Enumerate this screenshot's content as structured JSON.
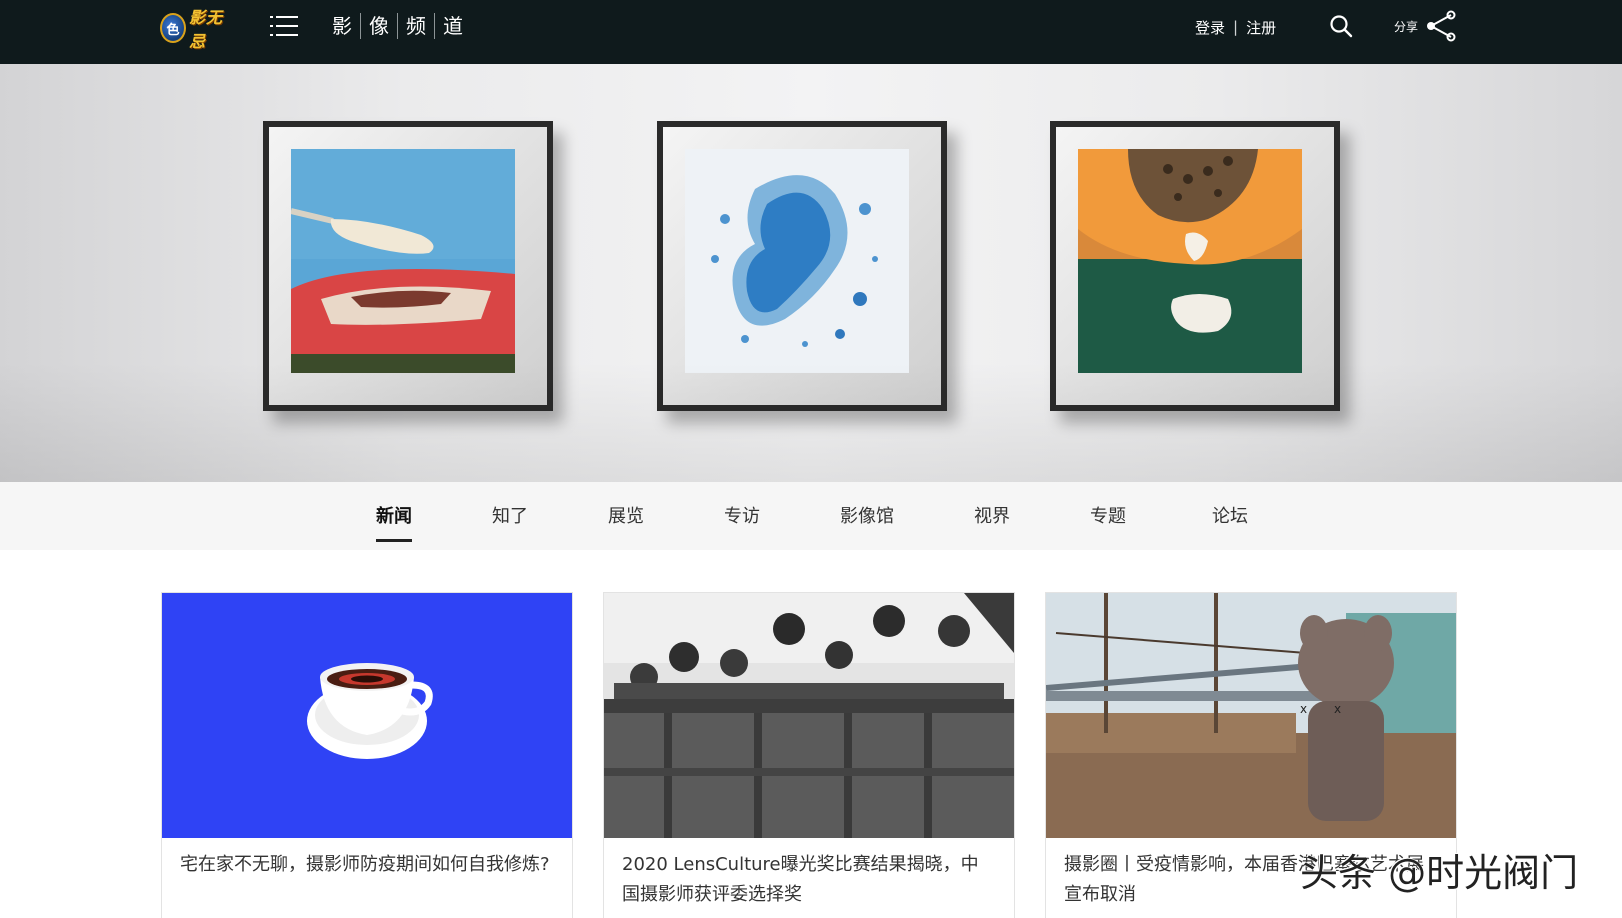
{
  "header": {
    "logo_text": "影无忌",
    "logo_mark": "色",
    "channel_chars": [
      "影",
      "像",
      "频",
      "道"
    ],
    "login_label": "登录",
    "separator": "|",
    "register_label": "注册",
    "share_label": "分享",
    "background_color": "#0f1a1c"
  },
  "carousel": {
    "slides": [
      {
        "subject": "ice cream bar on watermelon"
      },
      {
        "subject": "blue liquid with foam bubbles"
      },
      {
        "subject": "papaya on green fabric"
      }
    ],
    "dot_count": 3,
    "active_dot": 1
  },
  "tabs": [
    {
      "label": "新闻",
      "active": true
    },
    {
      "label": "知了",
      "active": false
    },
    {
      "label": "展览",
      "active": false
    },
    {
      "label": "专访",
      "active": false
    },
    {
      "label": "影像馆",
      "active": false
    },
    {
      "label": "视界",
      "active": false
    },
    {
      "label": "专题",
      "active": false
    },
    {
      "label": "论坛",
      "active": false
    }
  ],
  "cards": [
    {
      "caption": "宅在家不无聊，摄影师防疫期间如何自我修炼?"
    },
    {
      "caption": "2020 LensCulture曝光奖比赛结果揭晓，中国摄影师获评委选择奖"
    },
    {
      "caption": "摄影圈丨受疫情影响，本届香港巴塞尔艺术展宣布取消"
    }
  ],
  "watermark": "头条 @时光阀门",
  "colors": {
    "card_one_background": "#2f43f5",
    "tab_bar": "#f6f6f6"
  }
}
